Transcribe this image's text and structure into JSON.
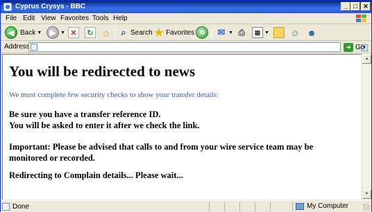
{
  "window": {
    "title": "Cyprus Crysys - BBC"
  },
  "title_buttons": {
    "minimize": "_",
    "maximize": "□",
    "close": "✕"
  },
  "menu": [
    {
      "label": "File"
    },
    {
      "label": "Edit"
    },
    {
      "label": "View"
    },
    {
      "label": "Favorites"
    },
    {
      "label": "Tools"
    },
    {
      "label": "Help"
    }
  ],
  "toolbar": {
    "back_label": "Back",
    "search_label": "Search",
    "favorites_label": "Favorites",
    "icons": [
      "back-icon",
      "forward-icon",
      "stop-icon",
      "refresh-icon",
      "home-icon",
      "search-icon",
      "favorites-star-icon",
      "history-icon",
      "mail-icon",
      "print-icon",
      "edit-icon",
      "folder-icon",
      "messenger-icon",
      "users-icon"
    ]
  },
  "address": {
    "label": "Address",
    "value": "",
    "go_label": "Go"
  },
  "content": {
    "heading": "You will be redirected to news",
    "subheading": "We must complete few security checks to show your transfer details:",
    "line1": "Be sure you have a transfer reference ID.",
    "line2": "You will be asked to enter it after we check the link.",
    "line3": "Important: Please be advised that calls to and from your wire service team may be",
    "line4": "monitored or recorded.",
    "line5": "Redirecting to Complain details... Please wait..."
  },
  "status": {
    "left": "Done",
    "zone": "My Computer"
  },
  "colors": {
    "title_bar": "#245EDC",
    "subheading": "#3a57a8",
    "chrome": "#ECE9D8"
  }
}
